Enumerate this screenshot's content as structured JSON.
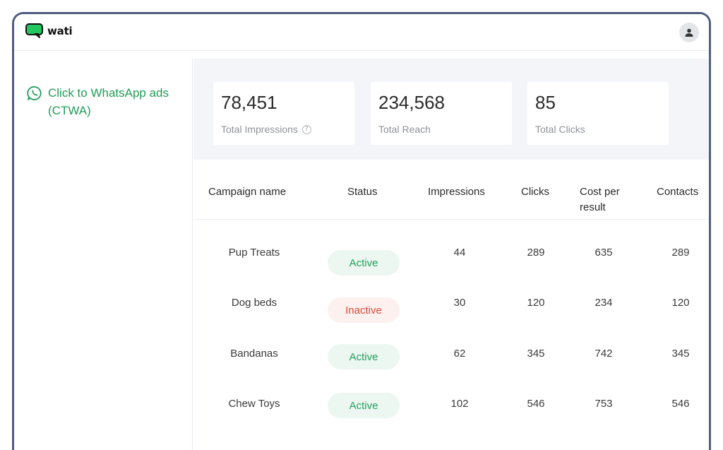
{
  "app": {
    "logo_text": "wati"
  },
  "sidebar": {
    "items": [
      {
        "label": "Click to WhatsApp ads (CTWA)",
        "icon": "whatsapp-icon"
      }
    ]
  },
  "stats": [
    {
      "value": "78,451",
      "label": "Total Impressions",
      "has_help": true
    },
    {
      "value": "234,568",
      "label": "Total Reach",
      "has_help": false
    },
    {
      "value": "85",
      "label": "Total Clicks",
      "has_help": false
    }
  ],
  "table": {
    "columns": [
      "Campaign name",
      "Status",
      "Impressions",
      "Clicks",
      "Cost per result",
      "Contacts"
    ],
    "rows": [
      {
        "name": "Pup Treats",
        "status": "Active",
        "impressions": "44",
        "clicks": "289",
        "cost": "635",
        "contacts": "289"
      },
      {
        "name": "Dog beds",
        "status": "Inactive",
        "impressions": "30",
        "clicks": "120",
        "cost": "234",
        "contacts": "120"
      },
      {
        "name": "Bandanas",
        "status": "Active",
        "impressions": "62",
        "clicks": "345",
        "cost": "742",
        "contacts": "345"
      },
      {
        "name": "Chew Toys",
        "status": "Active",
        "impressions": "102",
        "clicks": "546",
        "cost": "753",
        "contacts": "546"
      }
    ]
  },
  "colors": {
    "brand_green": "#1f9d55",
    "active_text": "#21a05a",
    "active_bg": "#edf7f2",
    "inactive_text": "#e2483a",
    "inactive_bg": "#fdf1ef",
    "frame_border": "#4f5d80"
  }
}
